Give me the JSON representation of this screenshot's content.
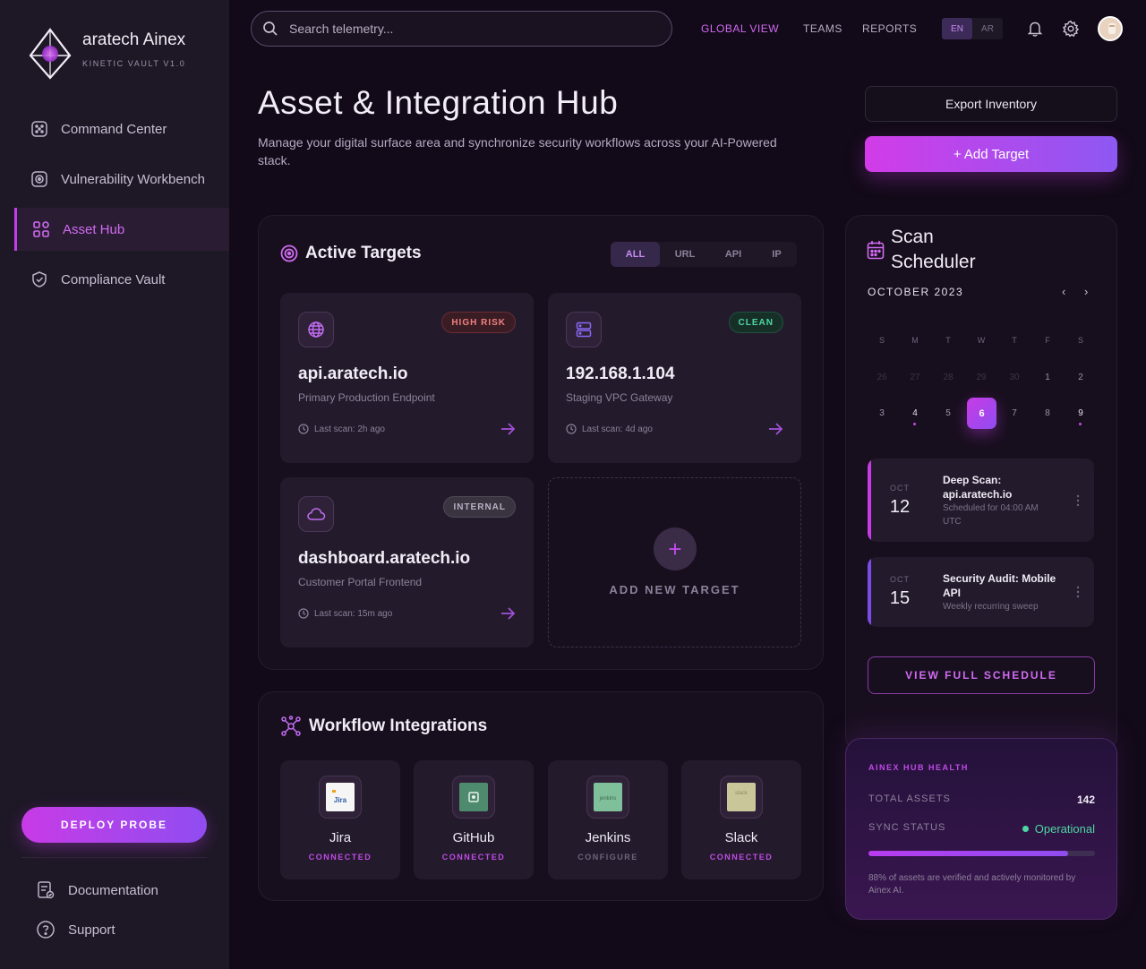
{
  "brand": {
    "name": "aratech Ainex",
    "subtitle": "KINETIC VAULT V1.0"
  },
  "sidebar": {
    "items": [
      {
        "label": "Command Center",
        "icon": "grid-dots-icon",
        "active": false
      },
      {
        "label": "Vulnerability Workbench",
        "icon": "target-scan-icon",
        "active": false
      },
      {
        "label": "Asset Hub",
        "icon": "apps-grid-icon",
        "active": true
      },
      {
        "label": "Compliance Vault",
        "icon": "shield-check-icon",
        "active": false
      }
    ],
    "deploy_label": "DEPLOY PROBE",
    "footer_links": [
      {
        "label": "Documentation",
        "icon": "document-icon"
      },
      {
        "label": "Support",
        "icon": "help-circle-icon"
      }
    ]
  },
  "topbar": {
    "search_placeholder": "Search telemetry...",
    "nav": [
      {
        "label": "GLOBAL VIEW",
        "active": true
      },
      {
        "label": "TEAMS",
        "active": false
      },
      {
        "label": "REPORTS",
        "active": false
      }
    ],
    "languages": [
      {
        "label": "EN",
        "active": true
      },
      {
        "label": "AR",
        "active": false
      }
    ]
  },
  "header": {
    "title": "Asset & Integration Hub",
    "description": "Manage your digital surface area and synchronize security workflows across your AI-Powered stack.",
    "export_label": "Export Inventory",
    "add_label": "+   Add Target"
  },
  "targets": {
    "title": "Active Targets",
    "filters": [
      {
        "label": "ALL",
        "active": true
      },
      {
        "label": "URL",
        "active": false
      },
      {
        "label": "API",
        "active": false
      },
      {
        "label": "IP",
        "active": false
      }
    ],
    "cards": [
      {
        "host": "api.aratech.io",
        "desc": "Primary Production Endpoint",
        "badge": "HIGH RISK",
        "badge_kind": "risk",
        "last_scan": "Last scan: 2h ago",
        "icon": "globe-icon"
      },
      {
        "host": "192.168.1.104",
        "desc": "Staging VPC Gateway",
        "badge": "CLEAN",
        "badge_kind": "clean",
        "last_scan": "Last scan: 4d ago",
        "icon": "server-icon"
      },
      {
        "host": "dashboard.aratech.io",
        "desc": "Customer Portal Frontend",
        "badge": "INTERNAL",
        "badge_kind": "internal",
        "last_scan": "Last scan: 15m ago",
        "icon": "cloud-icon"
      }
    ],
    "add_new_label": "ADD NEW TARGET"
  },
  "integrations": {
    "title": "Workflow Integrations",
    "items": [
      {
        "name": "Jira",
        "status": "CONNECTED",
        "logo_text": "Jira"
      },
      {
        "name": "GitHub",
        "status": "CONNECTED",
        "logo_text": ""
      },
      {
        "name": "Jenkins",
        "status": "CONFIGURE",
        "logo_text": "jenkins"
      },
      {
        "name": "Slack",
        "status": "CONNECTED",
        "logo_text": "slack"
      }
    ]
  },
  "scheduler": {
    "title_line1": "Scan",
    "title_line2": "Scheduler",
    "month": "OCTOBER 2023",
    "weekdays": [
      "S",
      "M",
      "T",
      "W",
      "T",
      "F",
      "S"
    ],
    "week1": [
      "26",
      "27",
      "28",
      "29",
      "30",
      "1",
      "2"
    ],
    "week2": [
      "3",
      "4",
      "5",
      "6",
      "7",
      "8",
      "9"
    ],
    "selected_day": "6",
    "events": [
      {
        "month": "OCT",
        "day": "12",
        "title": "Deep Scan: api.aratech.io",
        "subtitle": "Scheduled for 04:00 AM UTC"
      },
      {
        "month": "OCT",
        "day": "15",
        "title": "Security Audit: Mobile API",
        "subtitle": "Weekly recurring sweep"
      }
    ],
    "view_label": "VIEW FULL SCHEDULE"
  },
  "health": {
    "title": "AINEX HUB HEALTH",
    "total_assets_label": "TOTAL ASSETS",
    "total_assets_value": "142",
    "sync_label": "SYNC STATUS",
    "sync_value": "Operational",
    "progress_percent": 88,
    "note": "88% of assets are verified and actively monitored by Ainex AI."
  },
  "colors": {
    "accent": "#c83be6",
    "accent2": "#8f4df0",
    "success": "#4fd6a3",
    "danger": "#f08080"
  }
}
